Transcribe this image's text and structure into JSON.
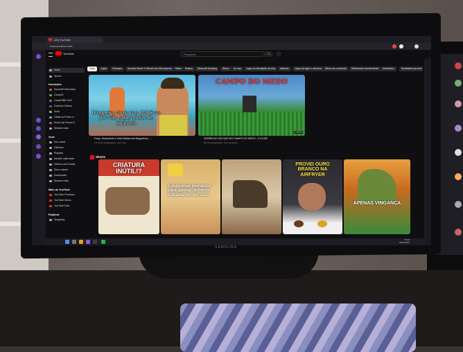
{
  "browser": {
    "tab_title": "(25) YouTube",
    "url": "www.youtube.com"
  },
  "youtube": {
    "logo_text": "YouTube",
    "search_placeholder": "Pesquisar",
    "chips": [
      "Tudo",
      "Jogos",
      "Podcasts",
      "Animals World: O Mundo dos Dinossauros",
      "Mixes",
      "Música",
      "Minecraft Modding",
      "Álbum",
      "Ao vivo",
      "Jogos de simulação de vida",
      "Naturais",
      "Jogos de ação e aventura",
      "Álbum de conversão",
      "Restaurado recentemente",
      "Assentidos",
      "Novidades pra você"
    ],
    "sidebar": {
      "items_top": [
        "Início",
        "Shorts"
      ],
      "section_subs": "Inscrições",
      "subs": [
        "SoundsPorEventos",
        "Canal M",
        "Canal RBD Vinil",
        "Damnís Críticas",
        "Sulla",
        "Olhidi na Ponte d...",
        "Enrico de Roma D...",
        "Mostrar mais"
      ],
      "section_you": "Você",
      "you_items": [
        "Seu canal",
        "Histórico",
        "Playlists",
        "Assistir mais tarde",
        "Vídeos com Gostei",
        "Seus vídeos",
        "Downloads",
        "Mostrar mais"
      ],
      "section_more": "Mais do YouTube",
      "more_items": [
        "YouTube Premium",
        "YouTube Music",
        "YouTube Kids"
      ],
      "section_explore": "Explorar",
      "explore_items": [
        "Shopping"
      ]
    },
    "videos": [
      {
        "title": "Forçs, Susembrar à Vida Saltida dos Blogueiros | ...",
        "overlay": "Blogueira chora nas Maldivas por não saber andar de bicicleta",
        "duration": "",
        "meta": "2.3 mi de visualizações · há 1 mês"
      },
      {
        "title": "SOBREVIVI 100 DIAS NO CAMPO DO MEDO - O FILME",
        "overlay": "CAMPO DO MEDO",
        "duration": "1:00:00",
        "meta": "90 mil visualizações · há 2 semanas"
      }
    ],
    "shorts_label": "Shorts",
    "shorts": [
      {
        "overlay": "CRIATURA INÚTIL!?"
      },
      {
        "overlay": "5 máquinas pequenas para ganhar dinheiro trabalhando em casa"
      },
      {
        "overlay": ""
      },
      {
        "overlay": "PROVEI OURO BRANCO NA AIRFRYER"
      },
      {
        "overlay": "APENAS VINGANÇA"
      }
    ]
  },
  "taskbar": {
    "time": "15:40",
    "date": "09/01/2024"
  },
  "monitor": {
    "brand": "SAMSUNG"
  }
}
